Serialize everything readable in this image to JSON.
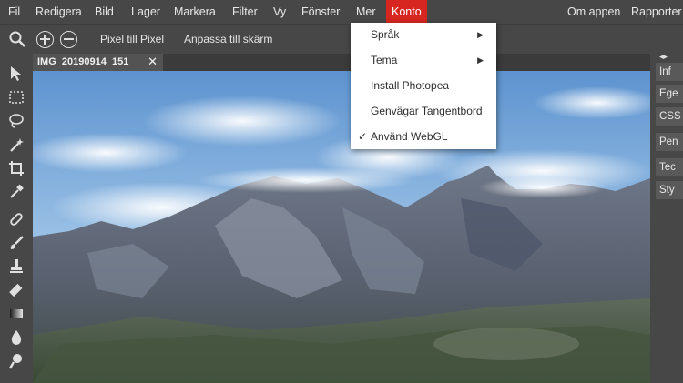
{
  "menubar": {
    "items": [
      {
        "label": "Fil"
      },
      {
        "label": "Redigera"
      },
      {
        "label": "Bild"
      },
      {
        "label": "Lager"
      },
      {
        "label": "Markera"
      },
      {
        "label": "Filter"
      },
      {
        "label": "Vy"
      },
      {
        "label": "Fönster"
      },
      {
        "label": "Mer"
      },
      {
        "label": "Konto"
      }
    ],
    "right_items": [
      {
        "label": "Om appen"
      },
      {
        "label": "Rapporter"
      }
    ]
  },
  "options_bar": {
    "pixel_label": "Pixel till Pixel",
    "fit_label": "Anpassa till skärm",
    "icons": [
      "zoom-icon",
      "zoom-in-icon",
      "zoom-out-icon"
    ]
  },
  "document": {
    "tab_title": "IMG_20190914_151",
    "close_glyph": "✕"
  },
  "dropdown": {
    "items": [
      {
        "label": "Språk",
        "submenu_glyph": "▶"
      },
      {
        "label": "Tema",
        "submenu_glyph": "▶"
      },
      {
        "label": "Install Photopea"
      },
      {
        "label": "Genvägar Tangentbord"
      },
      {
        "label": "Använd WebGL",
        "check_glyph": "✓"
      }
    ]
  },
  "right_panel": {
    "collapse_glyph": "◂▸",
    "items": [
      {
        "label": "Inf"
      },
      {
        "label": "Ege"
      },
      {
        "label": "CSS"
      },
      {
        "label": "Pen"
      },
      {
        "label": "Tec"
      },
      {
        "label": "Sty"
      }
    ]
  },
  "colors": {
    "accent": "#d6261f",
    "panel": "#474747",
    "dropdown_bg": "#ffffff"
  }
}
